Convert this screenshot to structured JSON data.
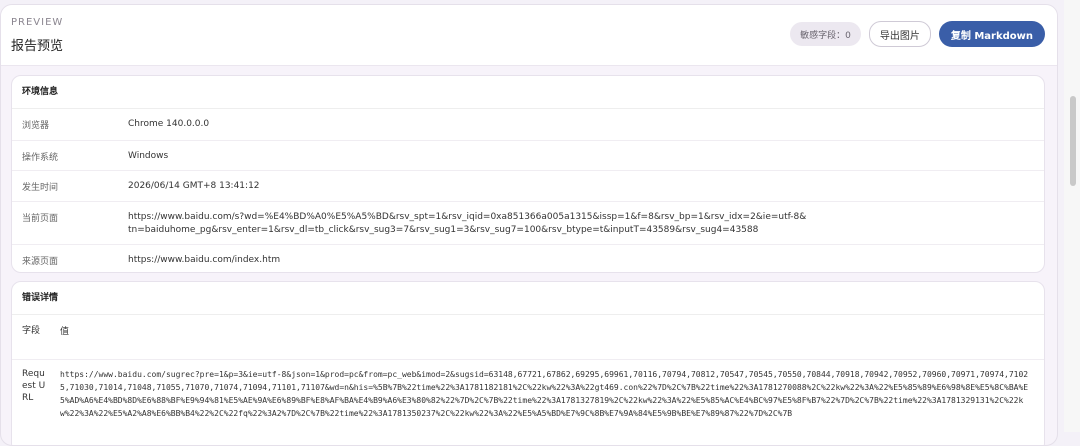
{
  "header": {
    "eyebrow": "PREVIEW",
    "title": "报告预览",
    "sensitive_badge": "敏感字段：0",
    "export_image": "导出图片",
    "copy_markdown": "复制 Markdown"
  },
  "env": {
    "title": "环境信息",
    "rows": [
      {
        "label": "浏览器",
        "value": "Chrome 140.0.0.0"
      },
      {
        "label": "操作系统",
        "value": "Windows"
      },
      {
        "label": "发生时间",
        "value": "2026/06/14 GMT+8 13:41:12"
      },
      {
        "label": "当前页面",
        "value": "https://www.baidu.com/s?wd=%E4%BD%A0%E5%A5%BD&rsv_spt=1&rsv_iqid=0xa851366a005a1315&issp=1&f=8&rsv_bp=1&rsv_idx=2&ie=utf-8&tn=baiduhome_pg&rsv_enter=1&rsv_dl=tb_click&rsv_sug3=7&rsv_sug1=3&rsv_sug7=100&rsv_btype=t&inputT=43589&rsv_sug4=43588"
      },
      {
        "label": "来源页面",
        "value": "https://www.baidu.com/index.htm"
      }
    ]
  },
  "error": {
    "title": "错误详情",
    "col_field": "字段",
    "col_value": "值",
    "rows": [
      {
        "label": "Request URL",
        "value": "https://www.baidu.com/sugrec?pre=1&p=3&ie=utf-8&json=1&prod=pc&from=pc_web&imod=2&sugsid=63148,67721,67862,69295,69961,70116,70794,70812,70547,70545,70550,70844,70918,70942,70952,70960,70971,70974,71025,71030,71014,71048,71055,71070,71074,71094,71101,71107&wd=n&his=%5B%7B%22time%22%3A1781182181%2C%22kw%22%3A%22gt469.con%22%7D%2C%7B%22time%22%3A1781270088%2C%22kw%22%3A%22%E5%85%89%E6%98%8E%E5%8C%BA%E5%AD%A6%E4%BD%8D%E6%88%BF%E9%94%81%E5%AE%9A%E6%89%BF%E8%AF%BA%E4%B9%A6%E3%80%82%22%7D%2C%7B%22time%22%3A1781327819%2C%22kw%22%3A%22%E5%85%AC%E4%BC%97%E5%8F%B7%22%7D%2C%7B%22time%22%3A1781329131%2C%22kw%22%3A%22%E5%A2%A8%E6%BB%B4%22%2C%22fq%22%3A2%7D%2C%7B%22time%22%3A1781350237%2C%22kw%22%3A%22%E5%A5%BD%E7%9C%8B%E7%9A%84%E5%9B%BE%E7%89%87%22%7D%2C%7B"
      }
    ]
  }
}
